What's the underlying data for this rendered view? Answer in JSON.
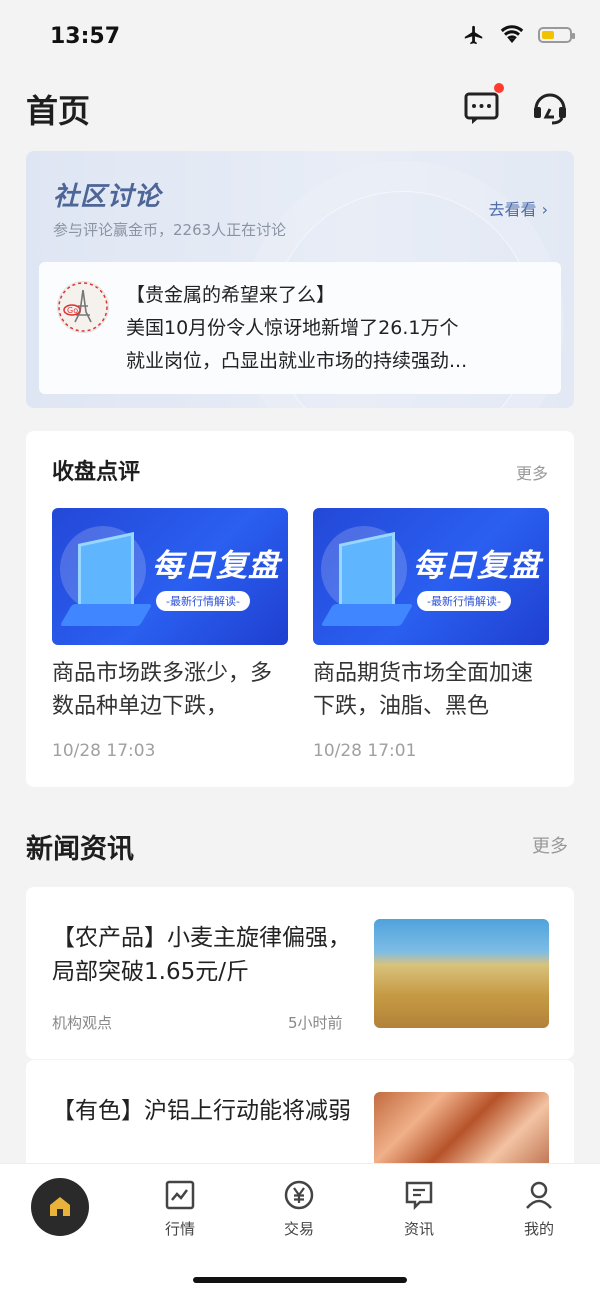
{
  "status": {
    "time": "13:57"
  },
  "header": {
    "title": "首页"
  },
  "community": {
    "title": "社区讨论",
    "subtitle": "参与评论赢金币，2263人正在讨论",
    "link": "去看看 ›",
    "post": {
      "line1": "【贵金属的希望来了么】",
      "line2": "美国10月份令人惊讶地新增了26.1万个",
      "line3": "就业岗位，凸显出就业市场的持续强劲..."
    }
  },
  "review": {
    "title": "收盘点评",
    "more": "更多",
    "items": [
      {
        "banner": "每日复盘",
        "banner_sub": "-最新行情解读-",
        "title": "商品市场跌多涨少，多数品种单边下跌，",
        "time": "10/28 17:03"
      },
      {
        "banner": "每日复盘",
        "banner_sub": "-最新行情解读-",
        "title": "商品期货市场全面加速下跌，油脂、黑色",
        "time": "10/28 17:01"
      }
    ]
  },
  "news": {
    "title": "新闻资讯",
    "more": "更多",
    "items": [
      {
        "title": "【农产品】小麦主旋律偏强，局部突破1.65元/斤",
        "source": "机构观点",
        "time": "5小时前"
      },
      {
        "title": "【有色】沪铝上行动能将减弱",
        "source": "",
        "time": ""
      }
    ]
  },
  "tabbar": {
    "tabs": [
      {
        "label": ""
      },
      {
        "label": "行情"
      },
      {
        "label": "交易"
      },
      {
        "label": "资讯"
      },
      {
        "label": "我的"
      }
    ]
  }
}
